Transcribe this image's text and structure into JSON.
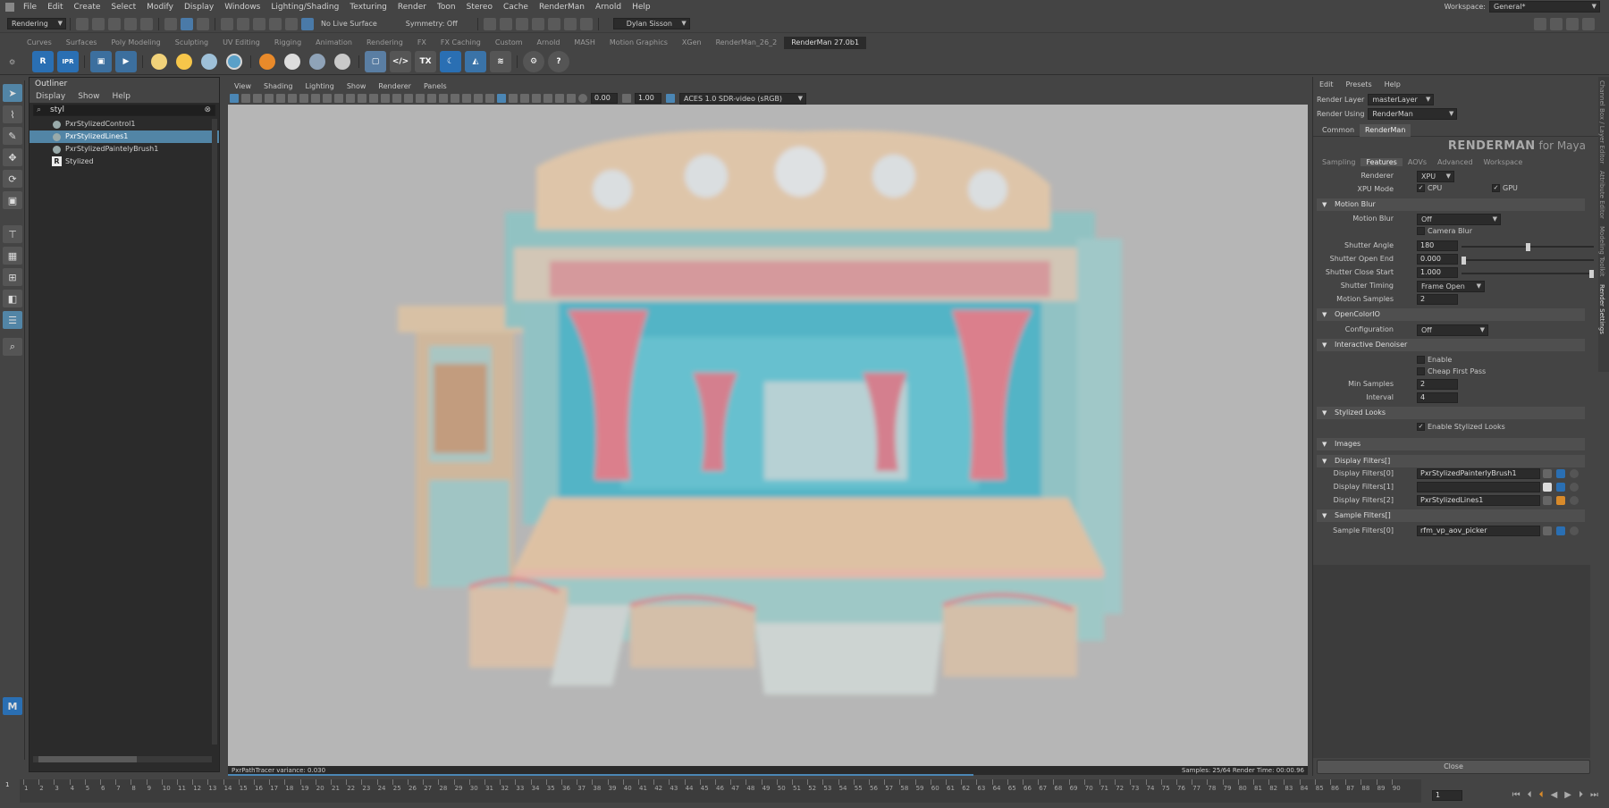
{
  "menubar": {
    "items": [
      "File",
      "Edit",
      "Create",
      "Select",
      "Modify",
      "Display",
      "Windows",
      "Lighting/Shading",
      "Texturing",
      "Render",
      "Toon",
      "Stereo",
      "Cache",
      "RenderMan",
      "Arnold",
      "Help"
    ],
    "workspace_label": "Workspace:",
    "workspace_value": "General*"
  },
  "statusline": {
    "menuset": "Rendering",
    "live_surface": "No Live Surface",
    "symmetry": "Symmetry: Off",
    "user": "Dylan Sisson"
  },
  "shelf": {
    "tabs": [
      "Curves",
      "Surfaces",
      "Poly Modeling",
      "Sculpting",
      "UV Editing",
      "Rigging",
      "Animation",
      "Rendering",
      "FX",
      "FX Caching",
      "Custom",
      "Arnold",
      "MASH",
      "Motion Graphics",
      "XGen",
      "RenderMan_26_2",
      "RenderMan 27.0b1"
    ],
    "active_tab": "RenderMan 27.0b1",
    "icons": {
      "r_label": "R",
      "ipr_label": "IPR",
      "tx_label": "TX"
    }
  },
  "outliner": {
    "title": "Outliner",
    "menu": [
      "Display",
      "Show",
      "Help"
    ],
    "search": "styl",
    "items": [
      {
        "label": "PxrStylizedControl1",
        "selected": false
      },
      {
        "label": "PxrStylizedLines1",
        "selected": true
      },
      {
        "label": "PxrStylizedPaintelyBrush1",
        "selected": false
      },
      {
        "label": "Stylized",
        "selected": false
      }
    ]
  },
  "viewport": {
    "menu": [
      "View",
      "Shading",
      "Lighting",
      "Show",
      "Renderer",
      "Panels"
    ],
    "exposure": "0.00",
    "gamma": "1.00",
    "colorspace": "ACES 1.0 SDR-video (sRGB)",
    "status_left": "PxrPathTracer  variance: 0.030",
    "status_right": "Samples: 25/64  Render Time: 00:00.96",
    "progress": 0.69
  },
  "render_settings": {
    "menu": [
      "Edit",
      "Presets",
      "Help"
    ],
    "render_layer_label": "Render Layer",
    "render_layer": "masterLayer",
    "render_using_label": "Render Using",
    "render_using": "RenderMan",
    "tabs": [
      "Common",
      "RenderMan"
    ],
    "active_tab": "RenderMan",
    "logo_bold": "RENDERMAN",
    "logo_rest": " for Maya",
    "subtabs": [
      "Sampling",
      "Features",
      "AOVs",
      "Advanced",
      "Workspace"
    ],
    "active_subtab": "Features",
    "renderer_label": "Renderer",
    "renderer": "XPU",
    "xpu_mode_label": "XPU Mode",
    "cpu_label": "CPU",
    "gpu_label": "GPU",
    "motion_blur": {
      "title": "Motion Blur",
      "motion_blur_label": "Motion Blur",
      "motion_blur_value": "Off",
      "camera_blur_label": "Camera Blur",
      "shutter_angle_label": "Shutter Angle",
      "shutter_angle": "180",
      "shutter_angle_level": 0.5,
      "shutter_open_label": "Shutter Open End",
      "shutter_open": "0.000",
      "shutter_open_level": 0.0,
      "shutter_close_label": "Shutter Close Start",
      "shutter_close": "1.000",
      "shutter_close_level": 1.0,
      "shutter_timing_label": "Shutter Timing",
      "shutter_timing": "Frame Open",
      "motion_samples_label": "Motion Samples",
      "motion_samples": "2"
    },
    "ocio": {
      "title": "OpenColorIO",
      "config_label": "Configuration",
      "config_value": "Off"
    },
    "denoiser": {
      "title": "Interactive Denoiser",
      "enable_label": "Enable",
      "cheap_label": "Cheap First Pass",
      "min_samples_label": "Min Samples",
      "min_samples": "2",
      "interval_label": "Interval",
      "interval": "4"
    },
    "stylized": {
      "title": "Stylized Looks",
      "enable_label": "Enable Stylized Looks"
    },
    "images_title": "Images",
    "display_filters": {
      "title": "Display Filters[]",
      "rows": [
        {
          "label": "Display Filters[0]",
          "value": "PxrStylizedPainterlyBrush1"
        },
        {
          "label": "Display Filters[1]",
          "value": ""
        },
        {
          "label": "Display Filters[2]",
          "value": "PxrStylizedLines1"
        }
      ]
    },
    "sample_filters": {
      "title": "Sample Filters[]",
      "rows": [
        {
          "label": "Sample Filters[0]",
          "value": "rfm_vp_aov_picker"
        }
      ]
    },
    "close_label": "Close"
  },
  "timeline": {
    "frames": [
      "1",
      "2",
      "3",
      "4",
      "5",
      "6",
      "7",
      "8",
      "9",
      "10",
      "11",
      "12",
      "13",
      "14",
      "15",
      "16",
      "17",
      "18",
      "19",
      "20",
      "21",
      "22",
      "23",
      "24",
      "25",
      "26",
      "27",
      "28",
      "29",
      "30",
      "31",
      "32",
      "33",
      "34",
      "35",
      "36",
      "37",
      "38",
      "39",
      "40",
      "41",
      "42",
      "43",
      "44",
      "45",
      "46",
      "47",
      "48",
      "49",
      "50",
      "51",
      "52",
      "53",
      "54",
      "55",
      "56",
      "57",
      "58",
      "59",
      "60",
      "61",
      "62",
      "63",
      "64",
      "65",
      "66",
      "67",
      "68",
      "69",
      "70",
      "71",
      "72",
      "73",
      "74",
      "75",
      "76",
      "77",
      "78",
      "79",
      "80",
      "81",
      "82",
      "83",
      "84",
      "85",
      "86",
      "87",
      "88",
      "89",
      "90"
    ],
    "current_frame": "1",
    "current_frame_below": "1"
  },
  "side_tabs": [
    "Channel Box / Layer Editor",
    "Attribute Editor",
    "Modeling Toolkit",
    "Render Settings"
  ]
}
